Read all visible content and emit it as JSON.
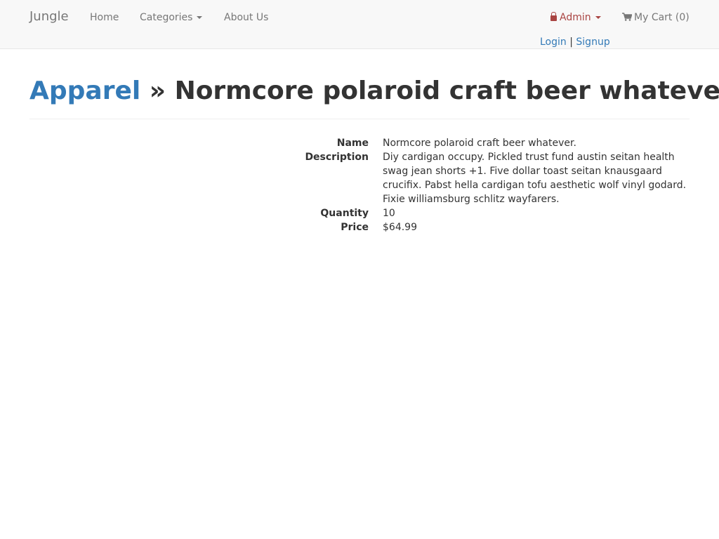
{
  "navbar": {
    "brand": "Jungle",
    "home": "Home",
    "categories": "Categories",
    "about": "About Us",
    "admin": "Admin",
    "cart": "My Cart (0)",
    "login": "Login",
    "separator": "|",
    "signup": "Signup"
  },
  "header": {
    "category": "Apparel",
    "separator": "»",
    "product_name": "Normcore polaroid craft beer whatever."
  },
  "details": {
    "name_label": "Name",
    "name_value": "Normcore polaroid craft beer whatever.",
    "description_label": "Description",
    "description_value": "Diy cardigan occupy. Pickled trust fund austin seitan health swag jean shorts +1. Five dollar toast seitan knausgaard crucifix. Pabst hella cardigan tofu aesthetic wolf vinyl godard. Fixie williamsburg schlitz wayfarers.",
    "quantity_label": "Quantity",
    "quantity_value": "10",
    "price_label": "Price",
    "price_value": "$64.99"
  },
  "colors": {
    "link": "#337ab7",
    "admin": "#a94442",
    "navbar_bg": "#f8f8f8",
    "nav_text": "#777777"
  },
  "icons": {
    "admin": "lock-icon",
    "cart": "shopping-cart-icon",
    "dropdown": "caret-down-icon"
  }
}
